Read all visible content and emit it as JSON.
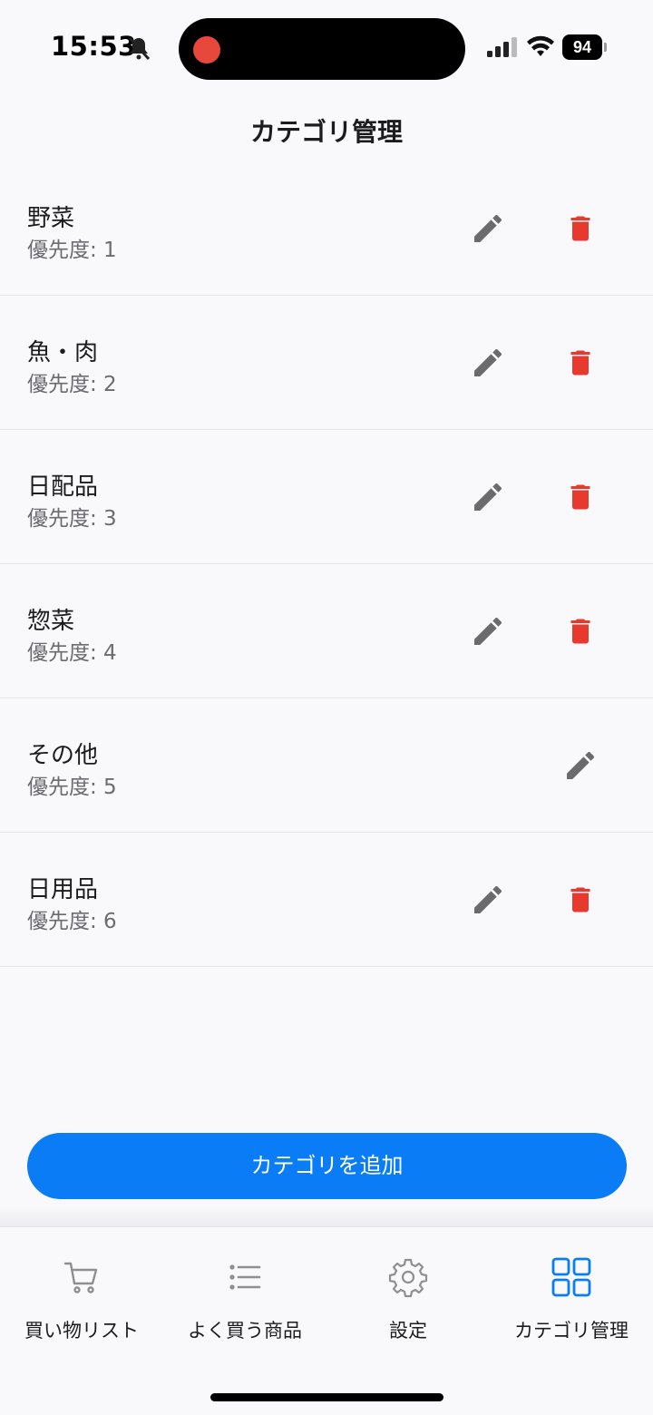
{
  "status_bar": {
    "time": "15:53",
    "battery": "94",
    "icons": [
      "bell-slash-icon",
      "recording-dot-icon",
      "cellular-signal-icon",
      "wifi-icon",
      "battery-icon"
    ]
  },
  "page": {
    "title": "カテゴリ管理"
  },
  "categories": [
    {
      "name": "野菜",
      "priority": "優先度: 1",
      "deletable": true
    },
    {
      "name": "魚・肉",
      "priority": "優先度: 2",
      "deletable": true
    },
    {
      "name": "日配品",
      "priority": "優先度: 3",
      "deletable": true
    },
    {
      "name": "惣菜",
      "priority": "優先度: 4",
      "deletable": true
    },
    {
      "name": "その他",
      "priority": "優先度: 5",
      "deletable": false
    },
    {
      "name": "日用品",
      "priority": "優先度: 6",
      "deletable": true
    }
  ],
  "actions": {
    "add_category": "カテゴリを追加",
    "edit_icon": "pencil-icon",
    "delete_icon": "trash-icon"
  },
  "tab_bar": {
    "active_tab": 3,
    "tabs": [
      {
        "label": "買い物リスト",
        "icon": "cart-icon"
      },
      {
        "label": "よく買う商品",
        "icon": "list-icon"
      },
      {
        "label": "設定",
        "icon": "gear-icon"
      },
      {
        "label": "カテゴリ管理",
        "icon": "grid-icon"
      }
    ]
  },
  "colors": {
    "accent": "#0a7cf5",
    "delete": "#e8392f",
    "icon_gray": "#6b6b6b",
    "inactive_tab": "#8e8e93"
  }
}
